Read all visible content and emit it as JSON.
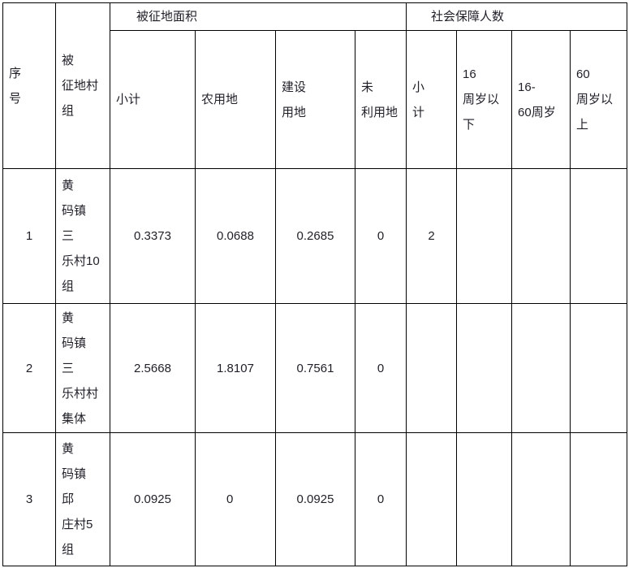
{
  "document": {
    "type": "land-acquisition-table",
    "title_present": false
  },
  "header": {
    "groups": [
      {
        "key": "area",
        "label": "被征地面积",
        "span": 4
      },
      {
        "key": "social",
        "label": "社会保障人数",
        "span": 4
      }
    ],
    "columns": [
      {
        "key": "seq",
        "lines": [
          "序",
          "号"
        ]
      },
      {
        "key": "village",
        "lines": [
          "被",
          "征地村",
          "组"
        ]
      },
      {
        "key": "area_sub",
        "lines": [
          "小计"
        ]
      },
      {
        "key": "farmland",
        "lines": [
          "农用地"
        ]
      },
      {
        "key": "construct",
        "lines": [
          "建设",
          "用地"
        ]
      },
      {
        "key": "unused",
        "lines": [
          "未",
          "利用地"
        ]
      },
      {
        "key": "soc_sub",
        "lines": [
          "小",
          "计"
        ]
      },
      {
        "key": "under16",
        "lines": [
          "16",
          "周岁以",
          "下"
        ]
      },
      {
        "key": "age16_60",
        "lines": [
          "16-",
          "60周岁"
        ]
      },
      {
        "key": "over60",
        "lines": [
          "60",
          "周岁以",
          "上"
        ]
      }
    ]
  },
  "rows": [
    {
      "seq": "1",
      "village_lines": [
        "黄",
        "码镇",
        "三",
        "乐村10",
        "组"
      ],
      "area_sub": "0.3373",
      "farmland": "0.0688",
      "construct": "0.2685",
      "unused": "0",
      "soc_sub": "2",
      "under16": "",
      "age16_60": "",
      "over60": ""
    },
    {
      "seq": "2",
      "village_lines": [
        "黄",
        "码镇",
        "三",
        "乐村村",
        "集体"
      ],
      "area_sub": "2.5668",
      "farmland": "1.8107",
      "construct": "0.7561",
      "unused": "0",
      "soc_sub": "",
      "under16": "",
      "age16_60": "",
      "over60": ""
    },
    {
      "seq": "3",
      "village_lines": [
        "黄",
        "码镇",
        "邱",
        "庄村5",
        "组"
      ],
      "area_sub": "0.0925",
      "farmland": "0",
      "construct": "0.0925",
      "unused": "0",
      "soc_sub": "",
      "under16": "",
      "age16_60": "",
      "over60": ""
    }
  ],
  "style": {
    "border_color": "#000000",
    "text_color": "#1f1f28",
    "background": "#ffffff"
  }
}
